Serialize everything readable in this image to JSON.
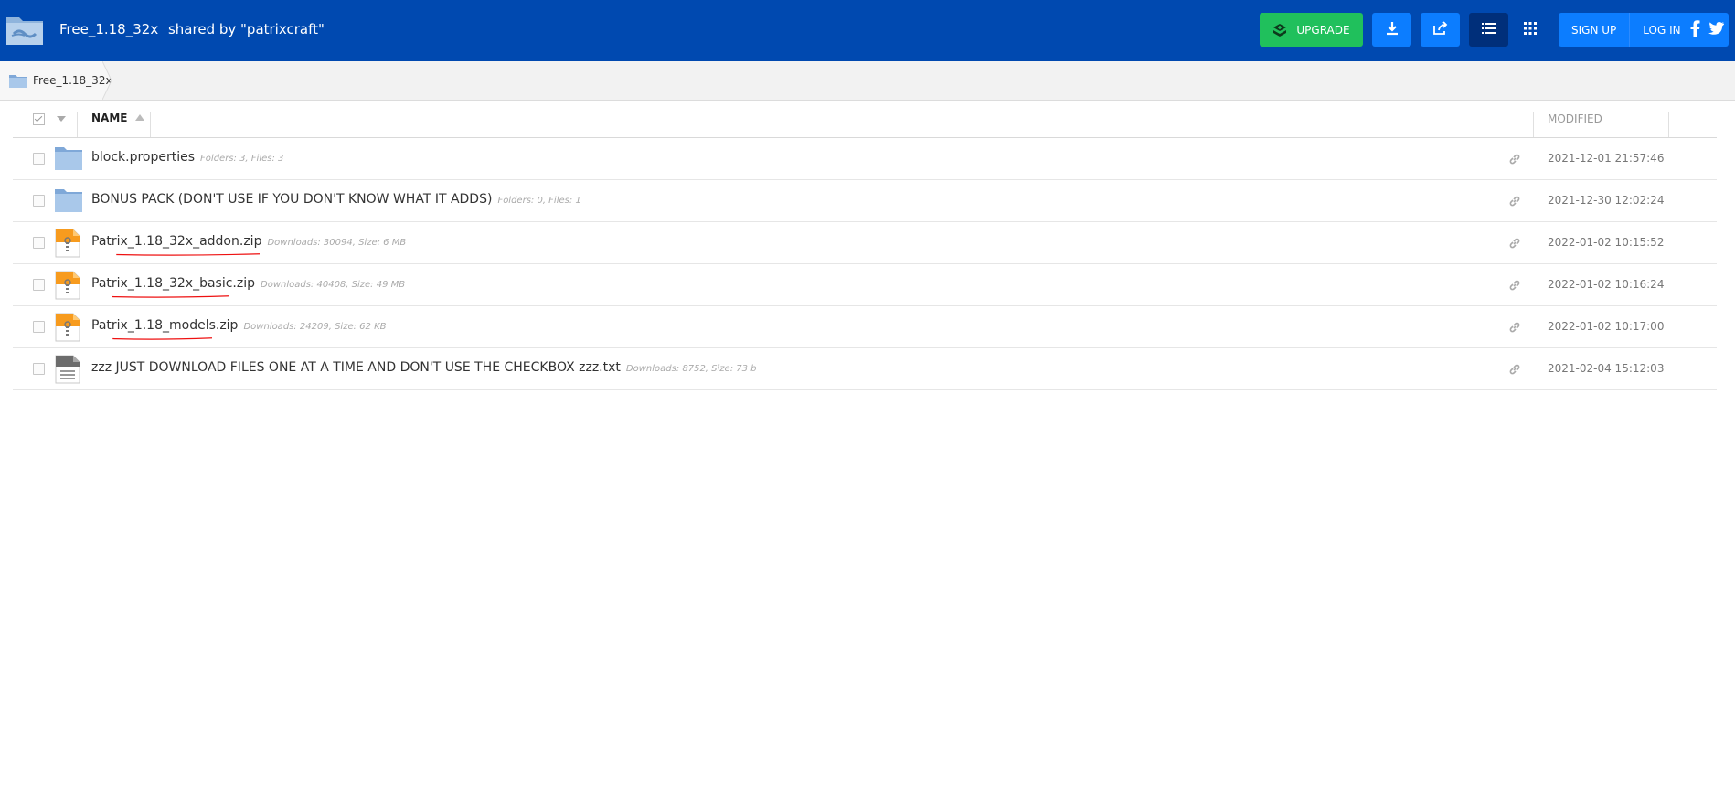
{
  "header": {
    "folder_name": "Free_1.18_32x",
    "shared_by": "shared by \"patrixcraft\"",
    "upgrade_label": "UPGRADE",
    "signup_label": "SIGN UP",
    "login_label": "LOG IN",
    "logo_icon": "folder-logo-icon",
    "colors": {
      "bar": "#0049b0",
      "upgrade": "#20c05c",
      "action": "#0c7dff",
      "active": "#002f7a"
    }
  },
  "breadcrumb": {
    "label": "Free_1.18_32x",
    "icon": "folder-icon"
  },
  "table": {
    "col_name": "NAME",
    "col_modified": "MODIFIED",
    "rows": [
      {
        "type": "folder",
        "name": "block.properties",
        "meta": "Folders: 3, Files: 3",
        "modified": "2021-12-01 21:57:46",
        "underlined": false
      },
      {
        "type": "folder",
        "name": "BONUS PACK (DON'T USE IF YOU DON'T KNOW WHAT IT ADDS)",
        "meta": "Folders: 0, Files: 1",
        "modified": "2021-12-30 12:02:24",
        "underlined": false
      },
      {
        "type": "zip",
        "name": "Patrix_1.18_32x_addon.zip",
        "meta": "Downloads: 30094, Size: 6 MB",
        "modified": "2022-01-02 10:15:52",
        "underlined": true
      },
      {
        "type": "zip",
        "name": "Patrix_1.18_32x_basic.zip",
        "meta": "Downloads: 40408, Size: 49 MB",
        "modified": "2022-01-02 10:16:24",
        "underlined": true
      },
      {
        "type": "zip",
        "name": "Patrix_1.18_models.zip",
        "meta": "Downloads: 24209, Size: 62 KB",
        "modified": "2022-01-02 10:17:00",
        "underlined": true
      },
      {
        "type": "txt",
        "name": "zzz JUST DOWNLOAD FILES ONE AT A TIME AND DON'T USE THE CHECKBOX zzz.txt",
        "meta": "Downloads: 8752, Size: 73 b",
        "modified": "2021-02-04 15:12:03",
        "underlined": false
      }
    ]
  }
}
